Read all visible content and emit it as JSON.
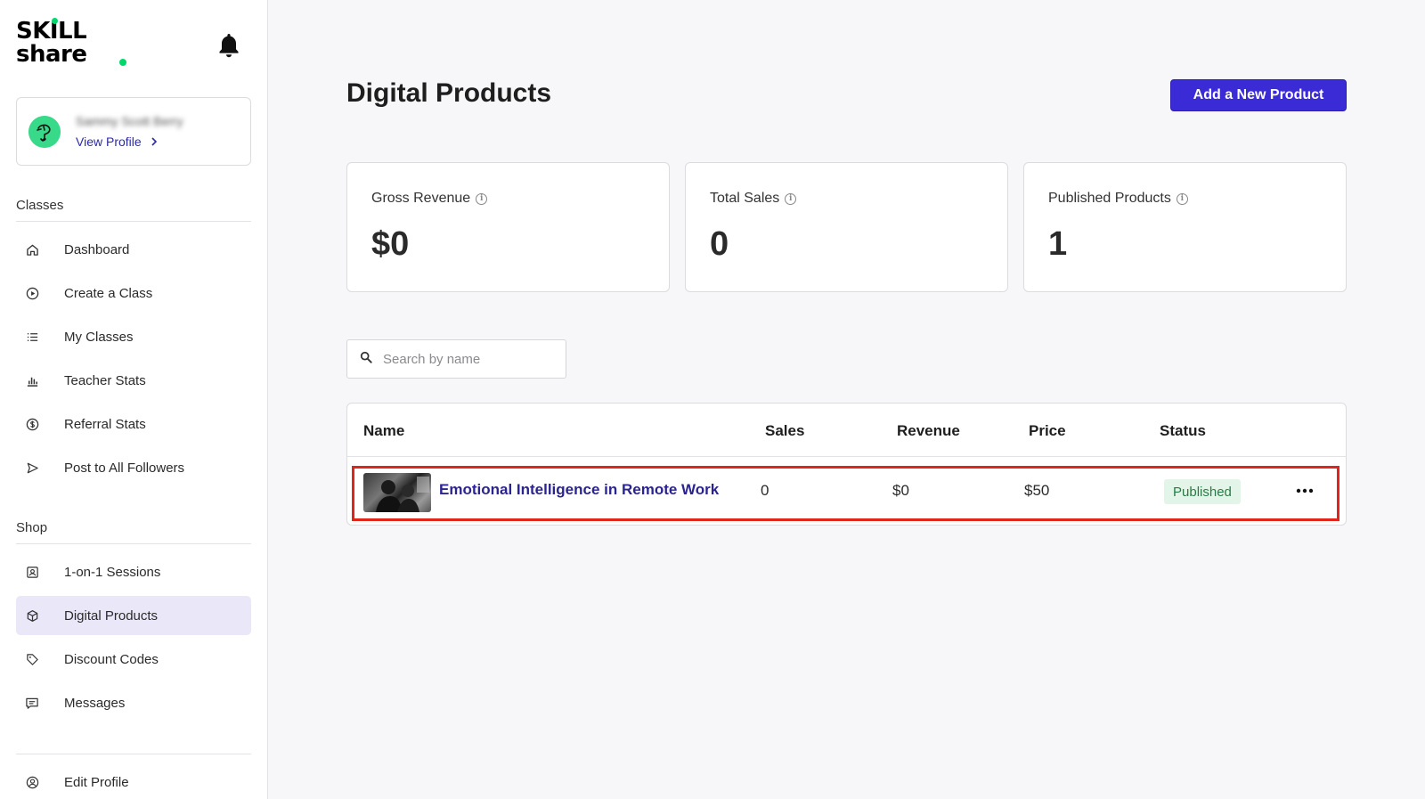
{
  "brand": {
    "line1": "SKILL",
    "line2": "share",
    "accent_color": "#00d86b"
  },
  "profile": {
    "name": "Sammy Scott Berry",
    "view_profile_label": "View Profile"
  },
  "sidebar": {
    "classes_label": "Classes",
    "classes_items": [
      {
        "label": "Dashboard",
        "icon": "home-icon"
      },
      {
        "label": "Create a Class",
        "icon": "play-circle-icon"
      },
      {
        "label": "My Classes",
        "icon": "list-icon"
      },
      {
        "label": "Teacher Stats",
        "icon": "bar-chart-icon"
      },
      {
        "label": "Referral Stats",
        "icon": "dollar-circle-icon"
      },
      {
        "label": "Post to All Followers",
        "icon": "send-icon"
      }
    ],
    "shop_label": "Shop",
    "shop_items": [
      {
        "label": "1-on-1 Sessions",
        "icon": "person-card-icon"
      },
      {
        "label": "Digital Products",
        "icon": "box-icon",
        "active": true
      },
      {
        "label": "Discount Codes",
        "icon": "tag-icon"
      },
      {
        "label": "Messages",
        "icon": "message-icon"
      }
    ],
    "footer_items": [
      {
        "label": "Edit Profile",
        "icon": "user-circle-icon"
      }
    ]
  },
  "page": {
    "title": "Digital Products",
    "add_button_label": "Add a New Product"
  },
  "stats": [
    {
      "label": "Gross Revenue",
      "value": "$0"
    },
    {
      "label": "Total Sales",
      "value": "0"
    },
    {
      "label": "Published Products",
      "value": "1"
    }
  ],
  "search": {
    "placeholder": "Search by name",
    "value": ""
  },
  "table": {
    "headers": {
      "name": "Name",
      "sales": "Sales",
      "revenue": "Revenue",
      "price": "Price",
      "status": "Status"
    },
    "rows": [
      {
        "name": "Emotional Intelligence in Remote Work",
        "sales": "0",
        "revenue": "$0",
        "price": "$50",
        "status": "Published"
      }
    ]
  },
  "colors": {
    "primary": "#3b2bd6",
    "link": "#2b2490",
    "highlight_border": "#e0261b",
    "badge_bg": "#e3f5e9",
    "badge_text": "#2a7a45",
    "active_nav_bg": "#e9e7f8"
  }
}
